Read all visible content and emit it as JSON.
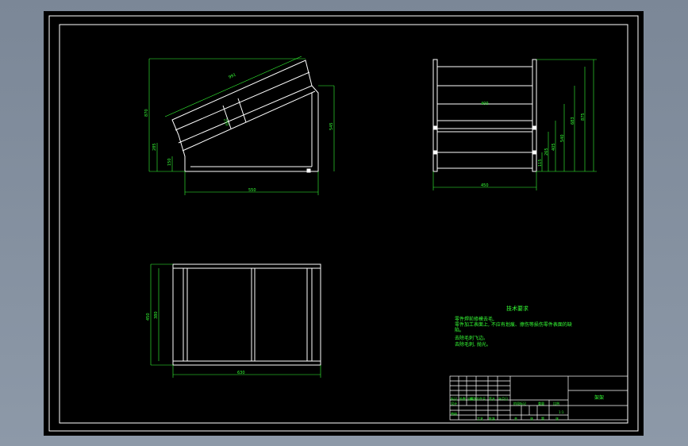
{
  "drawing": {
    "colors": {
      "background": "#000000",
      "outline": "#ffffff",
      "dimension": "#35ff35",
      "window_bg": "#8592a2"
    },
    "side_view": {
      "dims": {
        "diagonal": "991",
        "height_left": "870",
        "height_right": "545",
        "lower_1": "285",
        "lower_2": "150",
        "inner_depth": "250",
        "base": "550"
      }
    },
    "front_view": {
      "dims": {
        "width": "450",
        "inner": "400",
        "h1": "115",
        "h2": "265",
        "h3": "405",
        "h4": "540",
        "h5": "683",
        "h6": "875"
      }
    },
    "top_view": {
      "dims": {
        "length": "630",
        "depth": "450",
        "depth_inner": "380"
      }
    },
    "tech_requirements": {
      "title": "技术要求",
      "lines": [
        "零件焊前修模去毛,",
        "零件加工表面上, 不应有划痕、擦伤等损伤零件表面的缺",
        "陷。",
        "去除毛刺飞边。",
        "去除毛刺, 抛光。"
      ]
    },
    "title_block": {
      "name": "架架",
      "scale": "1:1",
      "headers": [
        "标记",
        "处数",
        "分区",
        "更改文件号",
        "签名",
        "年月日"
      ],
      "row_labels": [
        "设计",
        "审核",
        "工艺",
        "批准"
      ],
      "stage_headers": [
        "阶段标记",
        "重量",
        "比例"
      ],
      "footer": [
        "共",
        "张",
        "第",
        "张"
      ]
    }
  }
}
